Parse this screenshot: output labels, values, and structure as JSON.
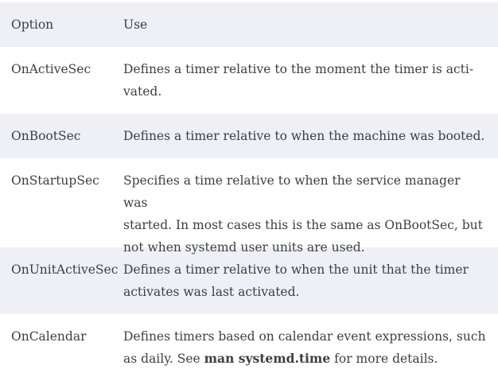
{
  "table": {
    "headers": {
      "option": "Option",
      "use": "Use"
    },
    "rows": [
      {
        "option": "OnActiveSec",
        "use_line1": "Defines a timer relative to the moment the timer is acti-",
        "use_line2": "vated."
      },
      {
        "option": "OnBootSec",
        "use_line1": "Defines a timer relative to when the machine was booted."
      },
      {
        "option": "OnStartupSec",
        "use_line1": "Specifies a time relative to when the service manager was",
        "use_line2": "started. In most cases this is the same as OnBootSec, but",
        "use_line3": "not when systemd user units are used."
      },
      {
        "option": "OnUnitActiveSec",
        "use_line1": "Defines a timer relative to when the unit that the timer",
        "use_line2": "activates was last activated."
      },
      {
        "option": "OnCalendar",
        "use_line1": "Defines timers based on calendar event expressions, such",
        "use_line2_pre": "as daily. See ",
        "use_line2_cmd": "man systemd.time",
        "use_line2_post": " for more details."
      }
    ]
  },
  "colors": {
    "row_shaded": "#eef0f5",
    "row_plain": "#ffffff",
    "text": "#3b3f45"
  }
}
